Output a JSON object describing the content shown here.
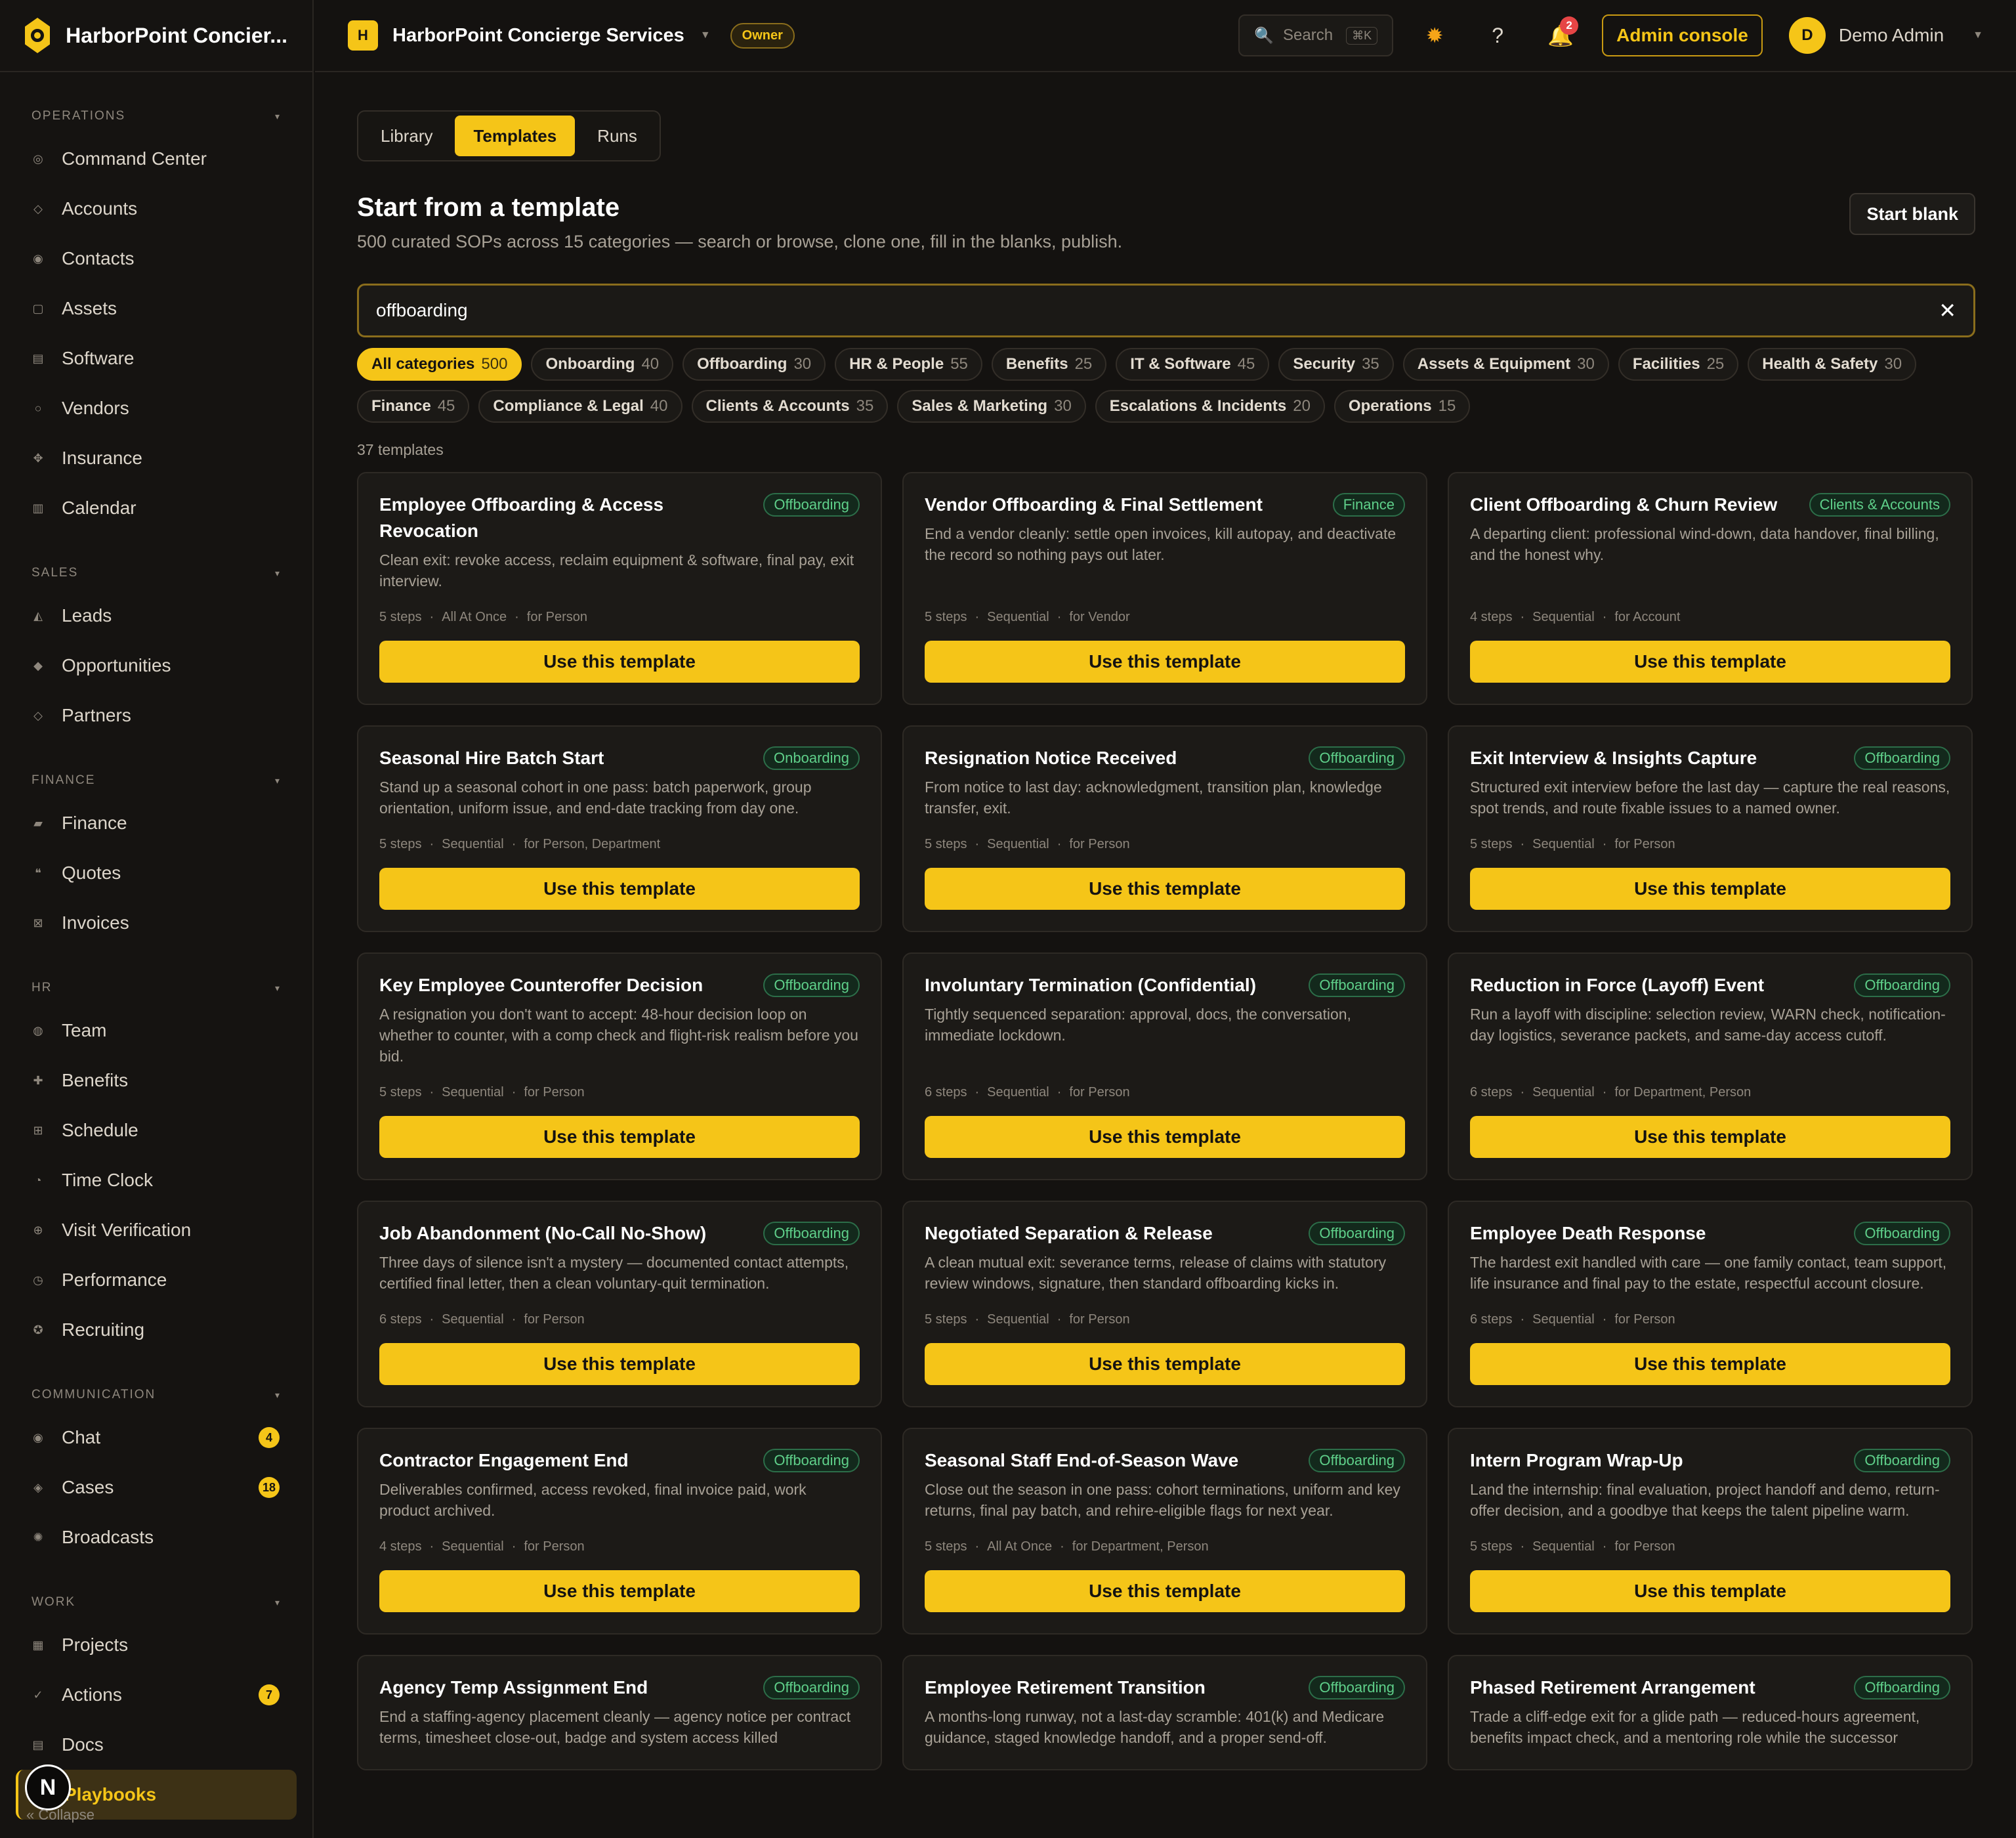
{
  "brand": {
    "name": "HarborPoint Concier..."
  },
  "sidebar": {
    "sections": [
      {
        "label": "OPERATIONS",
        "items": [
          {
            "label": "Command Center",
            "icon": "◎"
          },
          {
            "label": "Accounts",
            "icon": "◇"
          },
          {
            "label": "Contacts",
            "icon": "◉"
          },
          {
            "label": "Assets",
            "icon": "▢"
          },
          {
            "label": "Software",
            "icon": "▤"
          },
          {
            "label": "Vendors",
            "icon": "○"
          },
          {
            "label": "Insurance",
            "icon": "✥"
          },
          {
            "label": "Calendar",
            "icon": "▥"
          }
        ]
      },
      {
        "label": "SALES",
        "items": [
          {
            "label": "Leads",
            "icon": "◭"
          },
          {
            "label": "Opportunities",
            "icon": "◆"
          },
          {
            "label": "Partners",
            "icon": "◇"
          }
        ]
      },
      {
        "label": "FINANCE",
        "items": [
          {
            "label": "Finance",
            "icon": "▰"
          },
          {
            "label": "Quotes",
            "icon": "❝"
          },
          {
            "label": "Invoices",
            "icon": "⊠"
          }
        ]
      },
      {
        "label": "HR",
        "items": [
          {
            "label": "Team",
            "icon": "◍"
          },
          {
            "label": "Benefits",
            "icon": "✚"
          },
          {
            "label": "Schedule",
            "icon": "⊞"
          },
          {
            "label": "Time Clock",
            "icon": "◔"
          },
          {
            "label": "Visit Verification",
            "icon": "⊕"
          },
          {
            "label": "Performance",
            "icon": "◷"
          },
          {
            "label": "Recruiting",
            "icon": "✪"
          }
        ]
      },
      {
        "label": "COMMUNICATION",
        "items": [
          {
            "label": "Chat",
            "icon": "◉",
            "badge": "4"
          },
          {
            "label": "Cases",
            "icon": "◈",
            "badge": "18"
          },
          {
            "label": "Broadcasts",
            "icon": "✺"
          }
        ]
      },
      {
        "label": "WORK",
        "items": [
          {
            "label": "Projects",
            "icon": "▦"
          },
          {
            "label": "Actions",
            "icon": "✓",
            "badge": "7"
          },
          {
            "label": "Docs",
            "icon": "▤"
          },
          {
            "label": "Playbooks",
            "icon": "▣",
            "active": true
          }
        ]
      }
    ],
    "collapse_label": "« Collapse",
    "avatar_letter": "N"
  },
  "topbar": {
    "workspace_initial": "H",
    "workspace_name": "HarborPoint Concierge Services",
    "role_badge": "Owner",
    "search_label": "Search",
    "search_kbd": "⌘K",
    "notifications_count": "2",
    "admin_label": "Admin console",
    "user_initial": "D",
    "user_name": "Demo Admin"
  },
  "main": {
    "tabs": [
      {
        "label": "Library"
      },
      {
        "label": "Templates",
        "active": true
      },
      {
        "label": "Runs"
      }
    ],
    "title": "Start from a template",
    "subtitle": "500 curated SOPs across 15 categories — search or browse, clone one, fill in the blanks, publish.",
    "start_blank_label": "Start blank",
    "search_value": "offboarding",
    "clear_icon": "✕",
    "chips": [
      {
        "label": "All categories",
        "count": "500",
        "active": true
      },
      {
        "label": "Onboarding",
        "count": "40"
      },
      {
        "label": "Offboarding",
        "count": "30"
      },
      {
        "label": "HR & People",
        "count": "55"
      },
      {
        "label": "Benefits",
        "count": "25"
      },
      {
        "label": "IT & Software",
        "count": "45"
      },
      {
        "label": "Security",
        "count": "35"
      },
      {
        "label": "Assets & Equipment",
        "count": "30"
      },
      {
        "label": "Facilities",
        "count": "25"
      },
      {
        "label": "Health & Safety",
        "count": "30"
      },
      {
        "label": "Finance",
        "count": "45"
      },
      {
        "label": "Compliance & Legal",
        "count": "40"
      },
      {
        "label": "Clients & Accounts",
        "count": "35"
      },
      {
        "label": "Sales & Marketing",
        "count": "30"
      },
      {
        "label": "Escalations & Incidents",
        "count": "20"
      },
      {
        "label": "Operations",
        "count": "15"
      }
    ],
    "result_count": "37 templates",
    "use_label": "Use this template",
    "cards": [
      {
        "title": "Employee Offboarding & Access Revocation",
        "category": "Offboarding",
        "desc": "Clean exit: revoke access, reclaim equipment & software, final pay, exit interview.",
        "steps": "5 steps",
        "mode": "All At Once",
        "target": "for Person"
      },
      {
        "title": "Vendor Offboarding & Final Settlement",
        "category": "Finance",
        "desc": "End a vendor cleanly: settle open invoices, kill autopay, and deactivate the record so nothing pays out later.",
        "steps": "5 steps",
        "mode": "Sequential",
        "target": "for Vendor"
      },
      {
        "title": "Client Offboarding & Churn Review",
        "category": "Clients & Accounts",
        "desc": "A departing client: professional wind-down, data handover, final billing, and the honest why.",
        "steps": "4 steps",
        "mode": "Sequential",
        "target": "for Account"
      },
      {
        "title": "Seasonal Hire Batch Start",
        "category": "Onboarding",
        "desc": "Stand up a seasonal cohort in one pass: batch paperwork, group orientation, uniform issue, and end-date tracking from day one.",
        "steps": "5 steps",
        "mode": "Sequential",
        "target": "for Person, Department"
      },
      {
        "title": "Resignation Notice Received",
        "category": "Offboarding",
        "desc": "From notice to last day: acknowledgment, transition plan, knowledge transfer, exit.",
        "steps": "5 steps",
        "mode": "Sequential",
        "target": "for Person"
      },
      {
        "title": "Exit Interview & Insights Capture",
        "category": "Offboarding",
        "desc": "Structured exit interview before the last day — capture the real reasons, spot trends, and route fixable issues to a named owner.",
        "steps": "5 steps",
        "mode": "Sequential",
        "target": "for Person"
      },
      {
        "title": "Key Employee Counteroffer Decision",
        "category": "Offboarding",
        "desc": "A resignation you don't want to accept: 48-hour decision loop on whether to counter, with a comp check and flight-risk realism before you bid.",
        "steps": "5 steps",
        "mode": "Sequential",
        "target": "for Person"
      },
      {
        "title": "Involuntary Termination (Confidential)",
        "category": "Offboarding",
        "desc": "Tightly sequenced separation: approval, docs, the conversation, immediate lockdown.",
        "steps": "6 steps",
        "mode": "Sequential",
        "target": "for Person"
      },
      {
        "title": "Reduction in Force (Layoff) Event",
        "category": "Offboarding",
        "desc": "Run a layoff with discipline: selection review, WARN check, notification-day logistics, severance packets, and same-day access cutoff.",
        "steps": "6 steps",
        "mode": "Sequential",
        "target": "for Department, Person"
      },
      {
        "title": "Job Abandonment (No-Call No-Show)",
        "category": "Offboarding",
        "desc": "Three days of silence isn't a mystery — documented contact attempts, certified final letter, then a clean voluntary-quit termination.",
        "steps": "6 steps",
        "mode": "Sequential",
        "target": "for Person"
      },
      {
        "title": "Negotiated Separation & Release",
        "category": "Offboarding",
        "desc": "A clean mutual exit: severance terms, release of claims with statutory review windows, signature, then standard offboarding kicks in.",
        "steps": "5 steps",
        "mode": "Sequential",
        "target": "for Person"
      },
      {
        "title": "Employee Death Response",
        "category": "Offboarding",
        "desc": "The hardest exit handled with care — one family contact, team support, life insurance and final pay to the estate, respectful account closure.",
        "steps": "6 steps",
        "mode": "Sequential",
        "target": "for Person"
      },
      {
        "title": "Contractor Engagement End",
        "category": "Offboarding",
        "desc": "Deliverables confirmed, access revoked, final invoice paid, work product archived.",
        "steps": "4 steps",
        "mode": "Sequential",
        "target": "for Person"
      },
      {
        "title": "Seasonal Staff End-of-Season Wave",
        "category": "Offboarding",
        "desc": "Close out the season in one pass: cohort terminations, uniform and key returns, final pay batch, and rehire-eligible flags for next year.",
        "steps": "5 steps",
        "mode": "All At Once",
        "target": "for Department, Person"
      },
      {
        "title": "Intern Program Wrap-Up",
        "category": "Offboarding",
        "desc": "Land the internship: final evaluation, project handoff and demo, return-offer decision, and a goodbye that keeps the talent pipeline warm.",
        "steps": "5 steps",
        "mode": "Sequential",
        "target": "for Person"
      },
      {
        "title": "Agency Temp Assignment End",
        "category": "Offboarding",
        "desc": "End a staffing-agency placement cleanly — agency notice per contract terms, timesheet close-out, badge and system access killed",
        "steps": "",
        "mode": "",
        "target": ""
      },
      {
        "title": "Employee Retirement Transition",
        "category": "Offboarding",
        "desc": "A months-long runway, not a last-day scramble: 401(k) and Medicare guidance, staged knowledge handoff, and a proper send-off.",
        "steps": "",
        "mode": "",
        "target": ""
      },
      {
        "title": "Phased Retirement Arrangement",
        "category": "Offboarding",
        "desc": "Trade a cliff-edge exit for a glide path — reduced-hours agreement, benefits impact check, and a mentoring role while the successor",
        "steps": "",
        "mode": "",
        "target": ""
      }
    ]
  }
}
